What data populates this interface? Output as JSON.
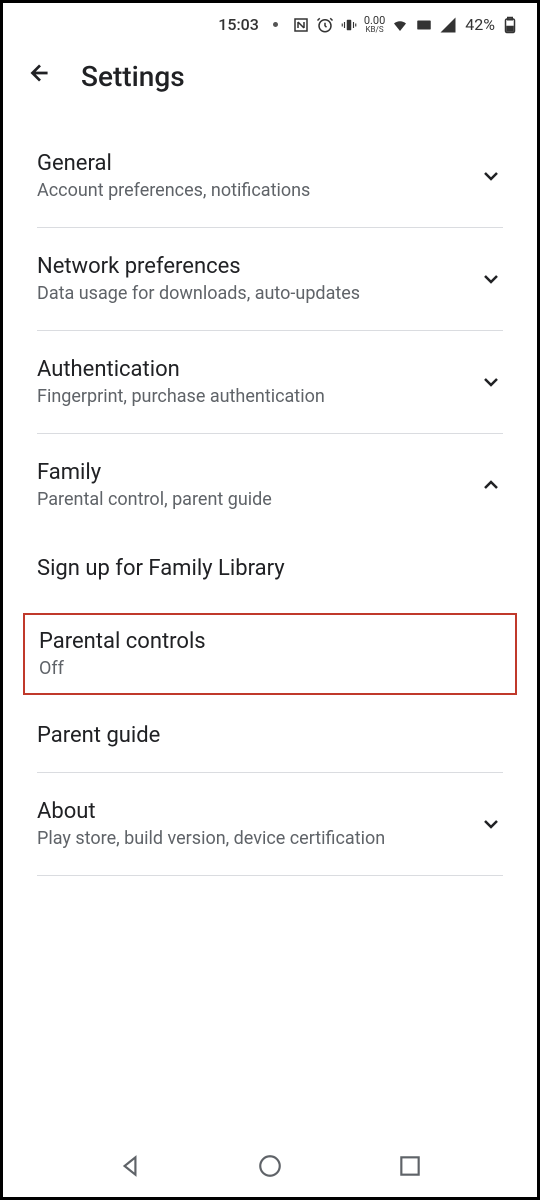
{
  "status": {
    "time": "15:03",
    "speed_value": "0.00",
    "speed_unit": "KB/S",
    "battery_percent": "42%"
  },
  "header": {
    "title": "Settings"
  },
  "sections": {
    "general": {
      "title": "General",
      "subtitle": "Account preferences, notifications"
    },
    "network": {
      "title": "Network preferences",
      "subtitle": "Data usage for downloads, auto-updates"
    },
    "auth": {
      "title": "Authentication",
      "subtitle": "Fingerprint, purchase authentication"
    },
    "family": {
      "title": "Family",
      "subtitle": "Parental control, parent guide",
      "sub1": "Sign up for Family Library",
      "sub2_title": "Parental controls",
      "sub2_status": "Off",
      "sub3": "Parent guide"
    },
    "about": {
      "title": "About",
      "subtitle": "Play store, build version, device certification"
    }
  }
}
